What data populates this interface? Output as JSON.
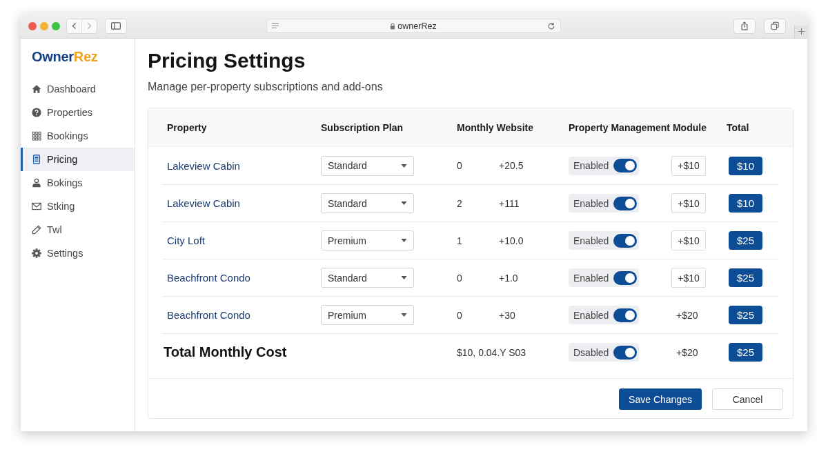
{
  "browser": {
    "address": "ownerRez"
  },
  "sidebar": {
    "logo": {
      "first": "Owner",
      "second": "Rez"
    },
    "items": [
      {
        "label": "Dashboard",
        "selected": false
      },
      {
        "label": "Properties",
        "selected": false
      },
      {
        "label": "Bookings",
        "selected": false
      },
      {
        "label": "Pricing",
        "selected": true
      },
      {
        "label": "Bokings",
        "selected": false
      },
      {
        "label": "Stking",
        "selected": false
      },
      {
        "label": "Twl",
        "selected": false
      },
      {
        "label": "Settings",
        "selected": false
      }
    ]
  },
  "page": {
    "title": "Pricing Settings",
    "subtitle": "Manage per-property subscriptions and add-ons"
  },
  "table": {
    "columns": [
      "Property",
      "Subscription Plan",
      "Monthly Website",
      "Property Management Module",
      "Total"
    ],
    "rows": [
      {
        "kind": "property",
        "property": "Lakeview Cabin",
        "plan": "Standard",
        "monthly_website": [
          "0",
          "+20.5"
        ],
        "module": {
          "status": "Enabled",
          "on": true,
          "addon": {
            "kind": "field",
            "text": "+$10"
          }
        },
        "total": "$10"
      },
      {
        "kind": "property",
        "property": "Lakeview Cabin",
        "plan": "Standard",
        "monthly_website": [
          "2",
          "+111"
        ],
        "module": {
          "status": "Enabled",
          "on": true,
          "addon": {
            "kind": "field",
            "text": "+$10"
          }
        },
        "total": "$10"
      },
      {
        "kind": "property",
        "property": "City Loft",
        "plan": "Premium",
        "monthly_website": [
          "1",
          "+10.0"
        ],
        "module": {
          "status": "Enabled",
          "on": true,
          "addon": {
            "kind": "field",
            "text": "+$10"
          }
        },
        "total": "$25"
      },
      {
        "kind": "property",
        "property": "Beachfront Condo",
        "plan": "Standard",
        "monthly_website": [
          "0",
          "+1.0"
        ],
        "module": {
          "status": "Enabled",
          "on": true,
          "addon": {
            "kind": "field",
            "text": "+$10"
          }
        },
        "total": "$25"
      },
      {
        "kind": "property",
        "property": "Beachfront Condo",
        "plan": "Premium",
        "monthly_website": [
          "0",
          "+30"
        ],
        "module": {
          "status": "Enabled",
          "on": true,
          "addon": {
            "kind": "text",
            "text": "+$20"
          }
        },
        "total": "$25"
      },
      {
        "kind": "total",
        "property": "Total Monthly Cost",
        "monthly_website": [
          "$10, 0.04.Y S03"
        ],
        "module": {
          "status": "Dsabled",
          "on": true,
          "addon": {
            "kind": "text",
            "text": "+$20"
          }
        },
        "total": "$25"
      }
    ]
  },
  "actions": [
    {
      "label": "Save Changes",
      "kind": "primary"
    },
    {
      "label": "Cancel",
      "kind": "secondary"
    }
  ]
}
